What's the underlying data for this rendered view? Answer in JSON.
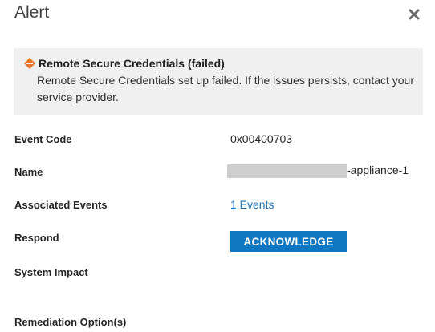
{
  "dialog": {
    "title": "Alert",
    "close_icon": "close-icon"
  },
  "alert": {
    "icon": "warning-diamond-icon",
    "icon_color": "#e8772e",
    "heading": "Remote Secure Credentials (failed)",
    "message": "Remote Secure Credentials set up failed. If the issues persists, contact your service provider."
  },
  "details": {
    "event_code_label": "Event Code",
    "event_code_value": "0x00400703",
    "name_label": "Name",
    "name_value_suffix": "-appliance-1",
    "associated_events_label": "Associated Events",
    "associated_events_value": "1 Events",
    "respond_label": "Respond",
    "acknowledge_button": "ACKNOWLEDGE",
    "system_impact_label": "System Impact",
    "remediation_label": "Remediation Option(s)"
  },
  "colors": {
    "button_bg": "#0f76c2",
    "link": "#1a73b8",
    "alert_bg": "#f0f0f0"
  }
}
